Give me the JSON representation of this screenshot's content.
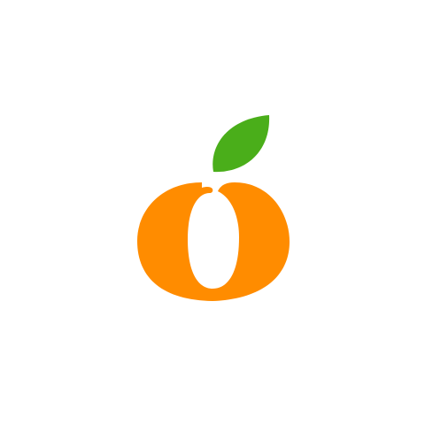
{
  "logo": {
    "icon": "orange-fruit-logo",
    "colors": {
      "background": "#ffffff",
      "fruit": "#FF8C00",
      "leaf": "#4AAE1A"
    }
  }
}
